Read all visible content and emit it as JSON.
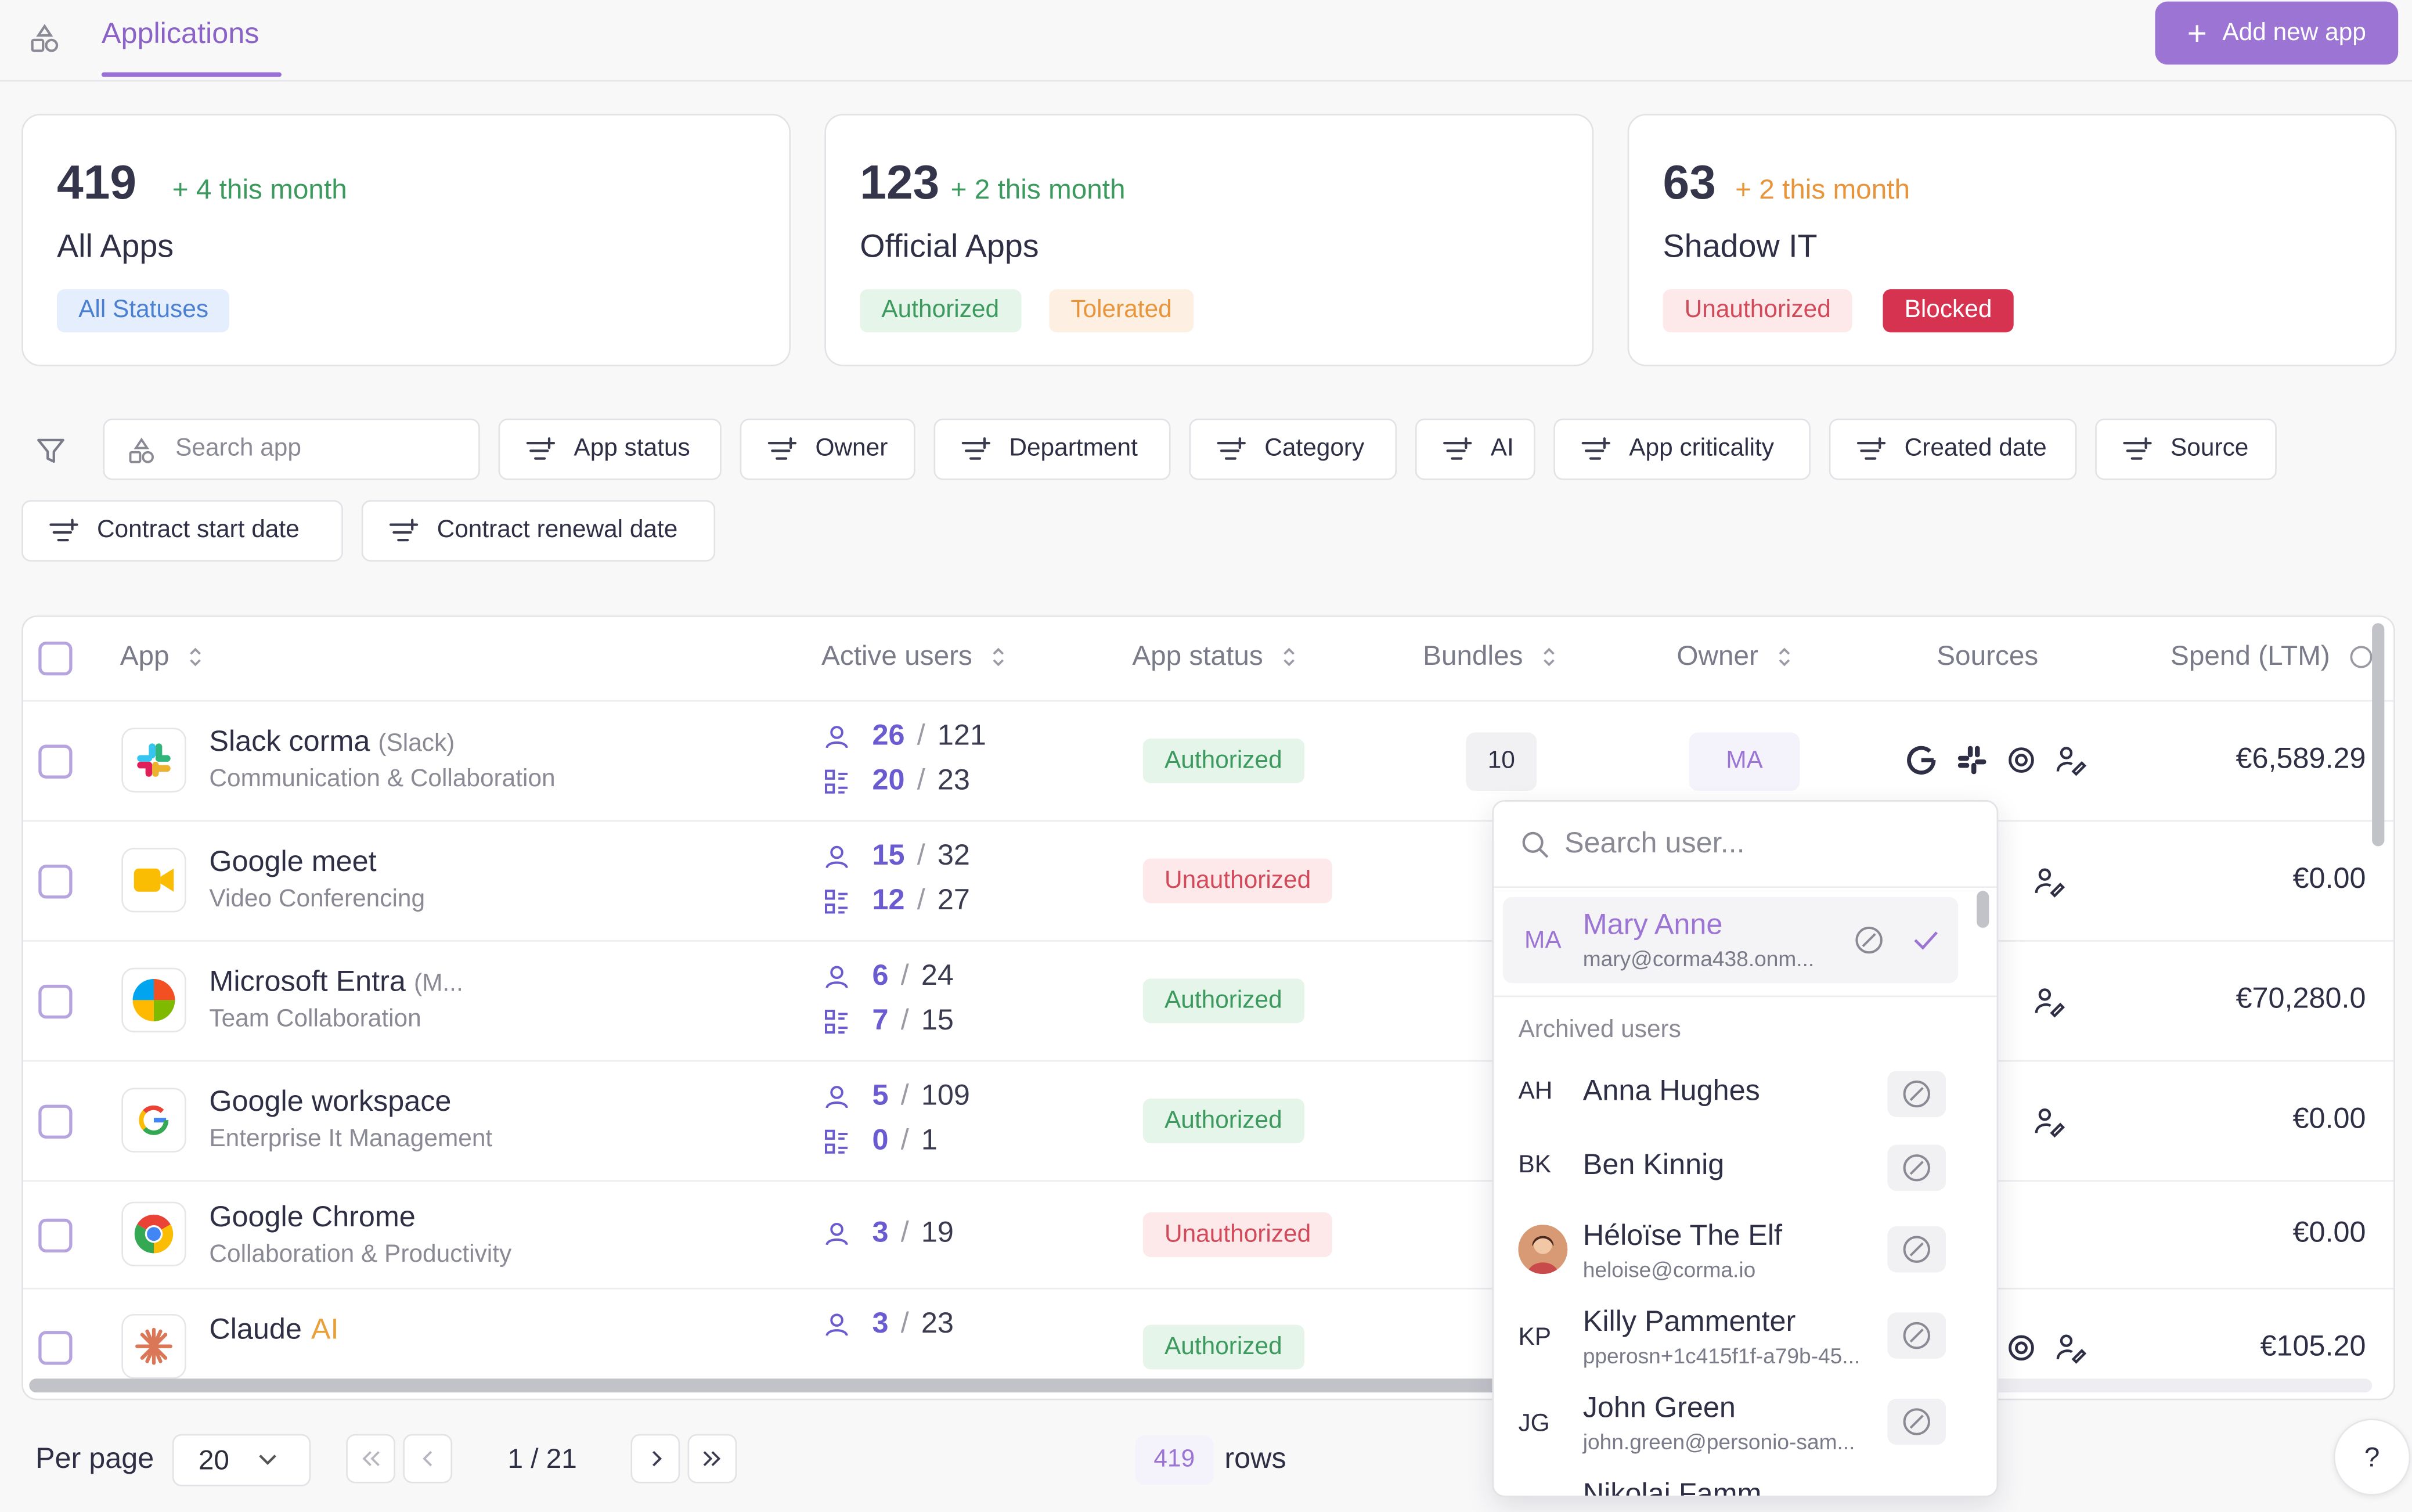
{
  "header": {
    "tab": "Applications",
    "add_button": "Add new app"
  },
  "cards": [
    {
      "count": "419",
      "delta": "+ 4 this month",
      "title": "All Apps",
      "pills": [
        "All Statuses"
      ]
    },
    {
      "count": "123",
      "delta": "+ 2 this month",
      "title": "Official Apps",
      "pills": [
        "Authorized",
        "Tolerated"
      ]
    },
    {
      "count": "63",
      "delta": "+ 2 this month",
      "title": "Shadow IT",
      "pills": [
        "Unauthorized",
        "Blocked"
      ]
    }
  ],
  "filters": {
    "search_placeholder": "Search app",
    "buttons": [
      "App status",
      "Owner",
      "Department",
      "Category",
      "AI",
      "App criticality",
      "Created date",
      "Source",
      "Contract start date",
      "Contract renewal date"
    ]
  },
  "table": {
    "columns": [
      "App",
      "Active users",
      "App status",
      "Bundles",
      "Owner",
      "Sources",
      "Spend (LTM)"
    ],
    "rows": [
      {
        "name": "Slack corma",
        "alias": "(Slack)",
        "category": "Communication & Collaboration",
        "active": "26",
        "total": "121",
        "active2": "20",
        "total2": "23",
        "status": "Authorized",
        "bundle": "10",
        "owner": "MA",
        "spend": "€6,589.29"
      },
      {
        "name": "Google meet",
        "category": "Video Conferencing",
        "active": "15",
        "total": "32",
        "active2": "12",
        "total2": "27",
        "status": "Unauthorized",
        "spend": "€0.00"
      },
      {
        "name": "Microsoft Entra",
        "alias": "(M...",
        "category": "Team Collaboration",
        "active": "6",
        "total": "24",
        "active2": "7",
        "total2": "15",
        "status": "Authorized",
        "spend": "€70,280.0"
      },
      {
        "name": "Google workspace",
        "category": "Enterprise It Management",
        "active": "5",
        "total": "109",
        "active2": "0",
        "total2": "1",
        "status": "Authorized",
        "spend": "€0.00"
      },
      {
        "name": "Google Chrome",
        "category": "Collaboration & Productivity",
        "active": "3",
        "total": "19",
        "status": "Unauthorized",
        "spend": "€0.00"
      },
      {
        "name": "Claude",
        "ai_tag": "AI",
        "active": "3",
        "total": "23",
        "status": "Authorized",
        "spend": "€105.20"
      }
    ]
  },
  "pagination": {
    "per_page_label": "Per page",
    "per_page": "20",
    "page": "1 / 21",
    "rows_count": "419",
    "rows_label": "rows",
    "help": "?"
  },
  "owner_dropdown": {
    "search_placeholder": "Search user...",
    "selected": {
      "initials": "MA",
      "name": "Mary Anne",
      "email": "mary@corma438.onm..."
    },
    "section_label": "Archived users",
    "users": [
      {
        "initials": "AH",
        "name": "Anna Hughes"
      },
      {
        "initials": "BK",
        "name": "Ben Kinnig"
      },
      {
        "initials": "",
        "name": "Héloïse The Elf",
        "email": "heloise@corma.io"
      },
      {
        "initials": "KP",
        "name": "Killy Pammenter",
        "email": "pperosn+1c415f1f-a79b-45..."
      },
      {
        "initials": "JG",
        "name": "John Green",
        "email": "john.green@personio-sam..."
      },
      {
        "initials": "",
        "name": "Nikolai Famm"
      }
    ]
  },
  "colors": {
    "accent": "#9b74d4",
    "authorized": "#3c9a5f",
    "unauthorized": "#d14a5a",
    "tolerated": "#e8943a",
    "blocked": "#d63350"
  }
}
